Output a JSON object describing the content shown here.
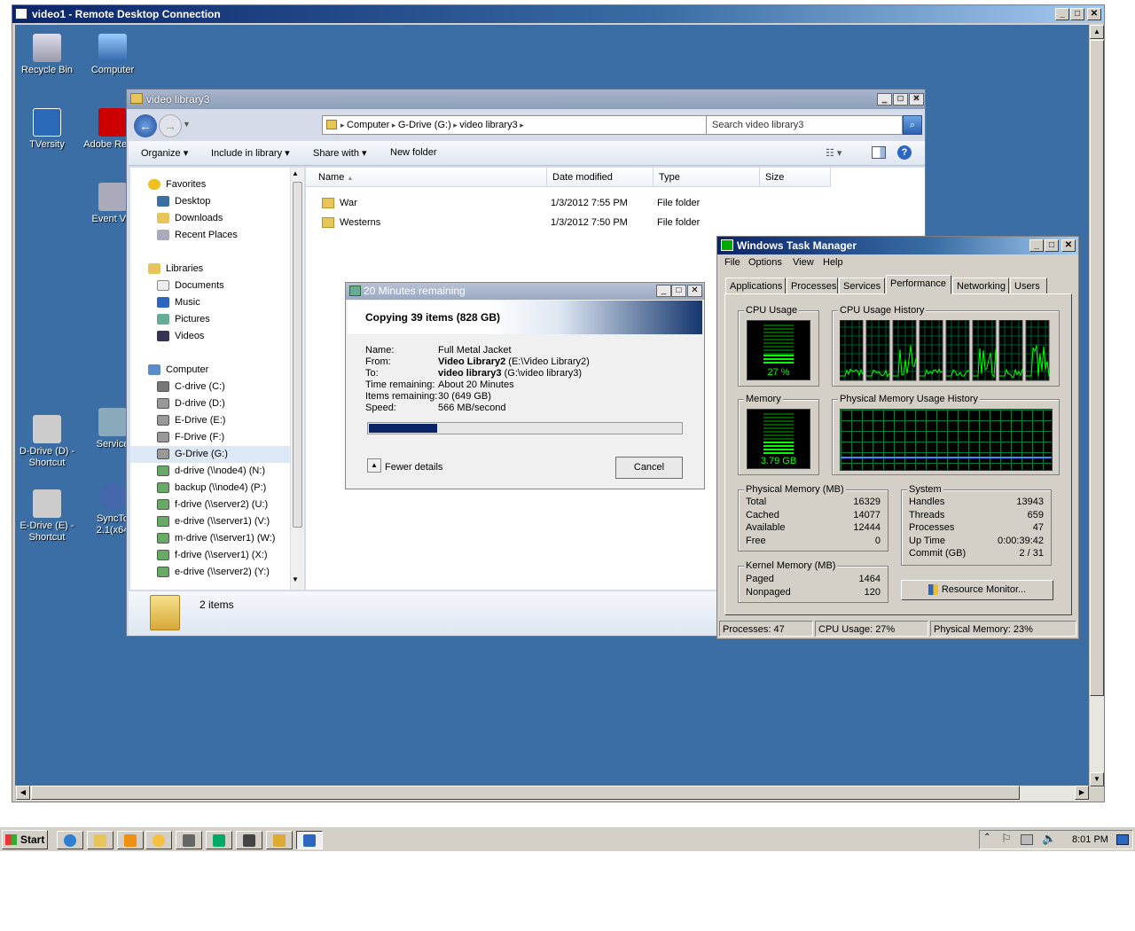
{
  "rdp": {
    "title": "video1 - Remote Desktop Connection"
  },
  "desktop": {
    "icons": [
      {
        "label": "Recycle Bin",
        "icon": "recycle-bin-icon"
      },
      {
        "label": "Computer",
        "icon": "computer-icon"
      },
      {
        "label": "TVersity",
        "icon": "tversity-icon"
      },
      {
        "label": "Adobe Rea X",
        "icon": "adobe-reader-icon"
      },
      {
        "label": "Event Vie",
        "icon": "event-viewer-icon"
      },
      {
        "label": "D-Drive (D) - Shortcut",
        "icon": "shortcut-icon"
      },
      {
        "label": "Service",
        "icon": "services-icon"
      },
      {
        "label": "E-Drive (E) - Shortcut",
        "icon": "shortcut-icon"
      },
      {
        "label": "SyncTo 2.1(x64",
        "icon": "synctoy-icon"
      }
    ]
  },
  "explorer": {
    "title": "video library3",
    "breadcrumb": [
      "Computer",
      "G-Drive (G:)",
      "video library3"
    ],
    "search_placeholder": "Search video library3",
    "toolbar": {
      "organize": "Organize",
      "include": "Include in library",
      "share": "Share with",
      "new_folder": "New folder"
    },
    "nav": {
      "favorites": "Favorites",
      "fav_items": [
        "Desktop",
        "Downloads",
        "Recent Places"
      ],
      "libraries": "Libraries",
      "lib_items": [
        "Documents",
        "Music",
        "Pictures",
        "Videos"
      ],
      "computer": "Computer",
      "drives": [
        "C-drive (C:)",
        "D-drive (D:)",
        "E-Drive (E:)",
        "F-Drive (F:)",
        "G-Drive (G:)",
        "d-drive (\\\\node4) (N:)",
        "backup (\\\\node4) (P:)",
        "f-drive (\\\\server2) (U:)",
        "e-drive (\\\\server1) (V:)",
        "m-drive (\\\\server1) (W:)",
        "f-drive (\\\\server1) (X:)",
        "e-drive (\\\\server2) (Y:)"
      ]
    },
    "columns": {
      "name": "Name",
      "date": "Date modified",
      "type": "Type",
      "size": "Size"
    },
    "files": [
      {
        "name": "War",
        "date": "1/3/2012 7:55 PM",
        "type": "File folder"
      },
      {
        "name": "Westerns",
        "date": "1/3/2012 7:50 PM",
        "type": "File folder"
      }
    ],
    "details": "2 items"
  },
  "copy": {
    "title": "20 Minutes remaining",
    "heading": "Copying 39 items (828 GB)",
    "labels": {
      "name": "Name:",
      "from": "From:",
      "to": "To:",
      "time": "Time remaining:",
      "items": "Items remaining:",
      "speed": "Speed:"
    },
    "name": "Full Metal Jacket",
    "from_bold": "Video Library2",
    "from_rest": " (E:\\Video Library2)",
    "to_bold": "video library3",
    "to_rest": " (G:\\video library3)",
    "time": "About 20 Minutes",
    "items": "30 (649 GB)",
    "speed": "566 MB/second",
    "progress": 0.22,
    "fewer": "Fewer details",
    "cancel": "Cancel"
  },
  "taskman": {
    "title": "Windows Task Manager",
    "menu": [
      "File",
      "Options",
      "View",
      "Help"
    ],
    "tabs": [
      "Applications",
      "Processes",
      "Services",
      "Performance",
      "Networking",
      "Users"
    ],
    "cpu_label": "CPU Usage",
    "cpu_value": "27 %",
    "cpu_hist_label": "CPU Usage History",
    "mem_label": "Memory",
    "mem_value": "3.79 GB",
    "mem_hist_label": "Physical Memory Usage History",
    "phys": {
      "label": "Physical Memory (MB)",
      "rows": [
        [
          "Total",
          "16329"
        ],
        [
          "Cached",
          "14077"
        ],
        [
          "Available",
          "12444"
        ],
        [
          "Free",
          "0"
        ]
      ]
    },
    "kernel": {
      "label": "Kernel Memory (MB)",
      "rows": [
        [
          "Paged",
          "1464"
        ],
        [
          "Nonpaged",
          "120"
        ]
      ]
    },
    "system": {
      "label": "System",
      "rows": [
        [
          "Handles",
          "13943"
        ],
        [
          "Threads",
          "659"
        ],
        [
          "Processes",
          "47"
        ],
        [
          "Up Time",
          "0:00:39:42"
        ],
        [
          "Commit (GB)",
          "2 / 31"
        ]
      ]
    },
    "resmon": "Resource Monitor...",
    "status": {
      "processes": "Processes: 47",
      "cpu": "CPU Usage: 27%",
      "mem": "Physical Memory: 23%"
    }
  },
  "taskbar": {
    "start": "Start",
    "clock": "8:01 PM"
  }
}
